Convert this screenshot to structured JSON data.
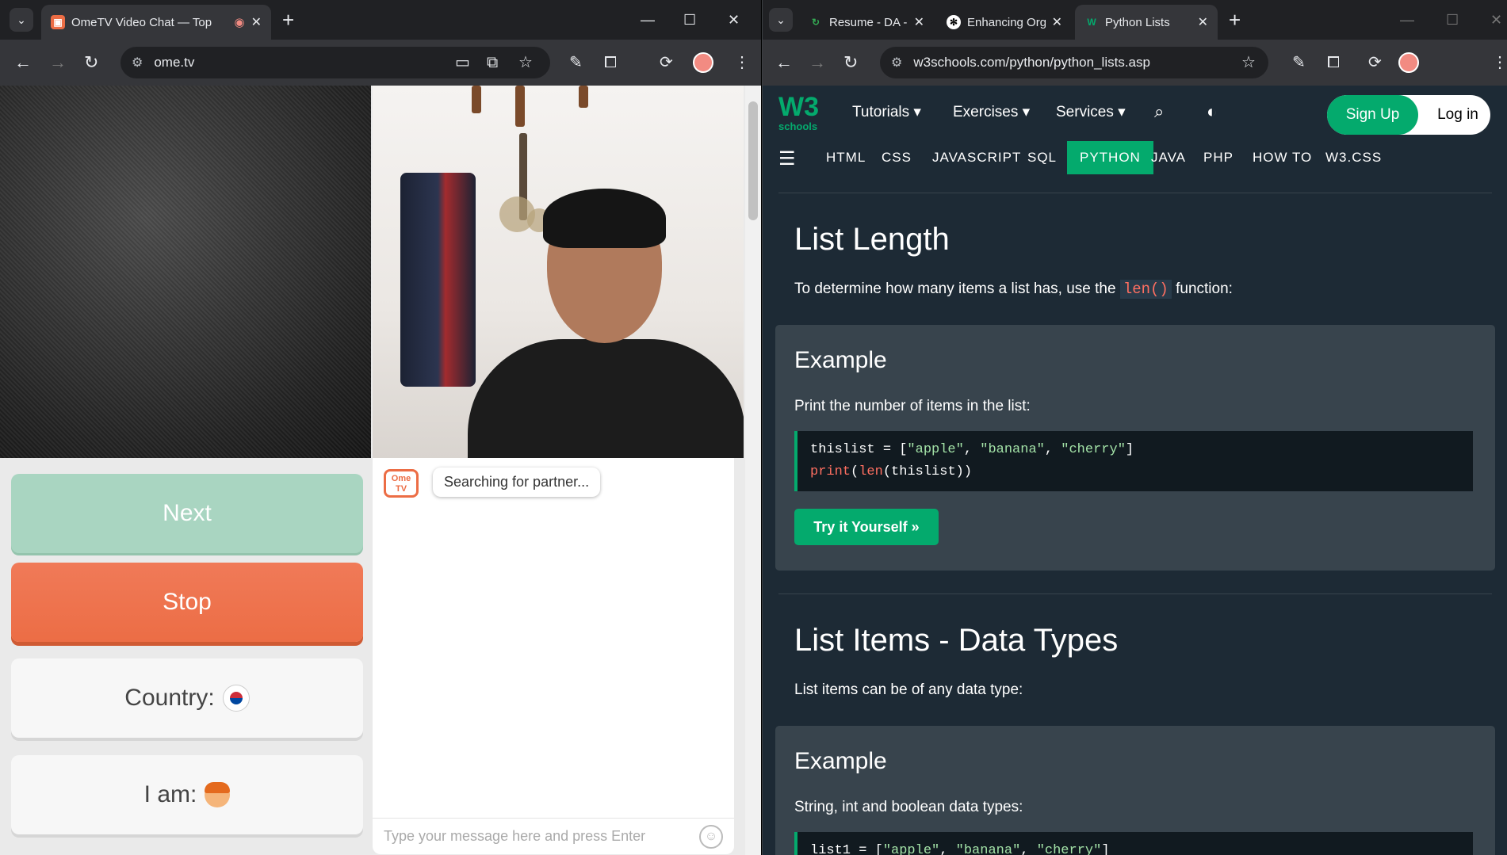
{
  "left_window": {
    "tab": {
      "title": "OmeTV Video Chat — Top",
      "favicon": "ometv-icon"
    },
    "url": "ome.tv",
    "ome": {
      "next_label": "Next",
      "stop_label": "Stop",
      "country_label": "Country:",
      "iam_label": "I am:",
      "logo_text": "Ome TV",
      "status": "Searching for partner...",
      "message_placeholder": "Type your message here and press Enter"
    }
  },
  "right_window": {
    "tabs": [
      {
        "title": "Resume - DA - Onl"
      },
      {
        "title": "Enhancing Organiz"
      },
      {
        "title": "Python Lists"
      }
    ],
    "url": "w3schools.com/python/python_lists.asp",
    "w3": {
      "logo_main": "W3",
      "logo_sub": "schools",
      "menu": [
        "Tutorials ▾",
        "Exercises ▾",
        "Services ▾"
      ],
      "signup": "Sign Up",
      "login": "Log in",
      "topics": [
        "HTML",
        "CSS",
        "JAVASCRIPT",
        "SQL",
        "PYTHON",
        "JAVA",
        "PHP",
        "HOW TO",
        "W3.CSS"
      ],
      "section1": {
        "title": "List Length",
        "intro_before": "To determine how many items a list has, use the ",
        "intro_code": "len()",
        "intro_after": " function:",
        "example_title": "Example",
        "example_text": "Print the number of items in the list:",
        "code_line1_a": "thislist = [",
        "code_line1_s1": "\"apple\"",
        "code_line1_c1": ", ",
        "code_line1_s2": "\"banana\"",
        "code_line1_c2": ", ",
        "code_line1_s3": "\"cherry\"",
        "code_line1_end": "]",
        "code_line2_kw1": "print",
        "code_line2_a": "(",
        "code_line2_kw2": "len",
        "code_line2_b": "(thislist))",
        "try_label": "Try it Yourself »"
      },
      "section2": {
        "title": "List Items - Data Types",
        "intro": "List items can be of any data type:",
        "example_title": "Example",
        "example_text": "String, int and boolean data types:",
        "code_line1_a": "list1 = [",
        "code_line1_s1": "\"apple\"",
        "code_line1_c1": ", ",
        "code_line1_s2": "\"banana\"",
        "code_line1_c2": ", ",
        "code_line1_s3": "\"cherry\"",
        "code_line1_end": "]"
      }
    }
  },
  "colors": {
    "w3_green": "#04aa6d",
    "ome_orange": "#ec6d45",
    "ome_mint": "#a9d5c1",
    "w3_bg": "#1d2a35"
  }
}
